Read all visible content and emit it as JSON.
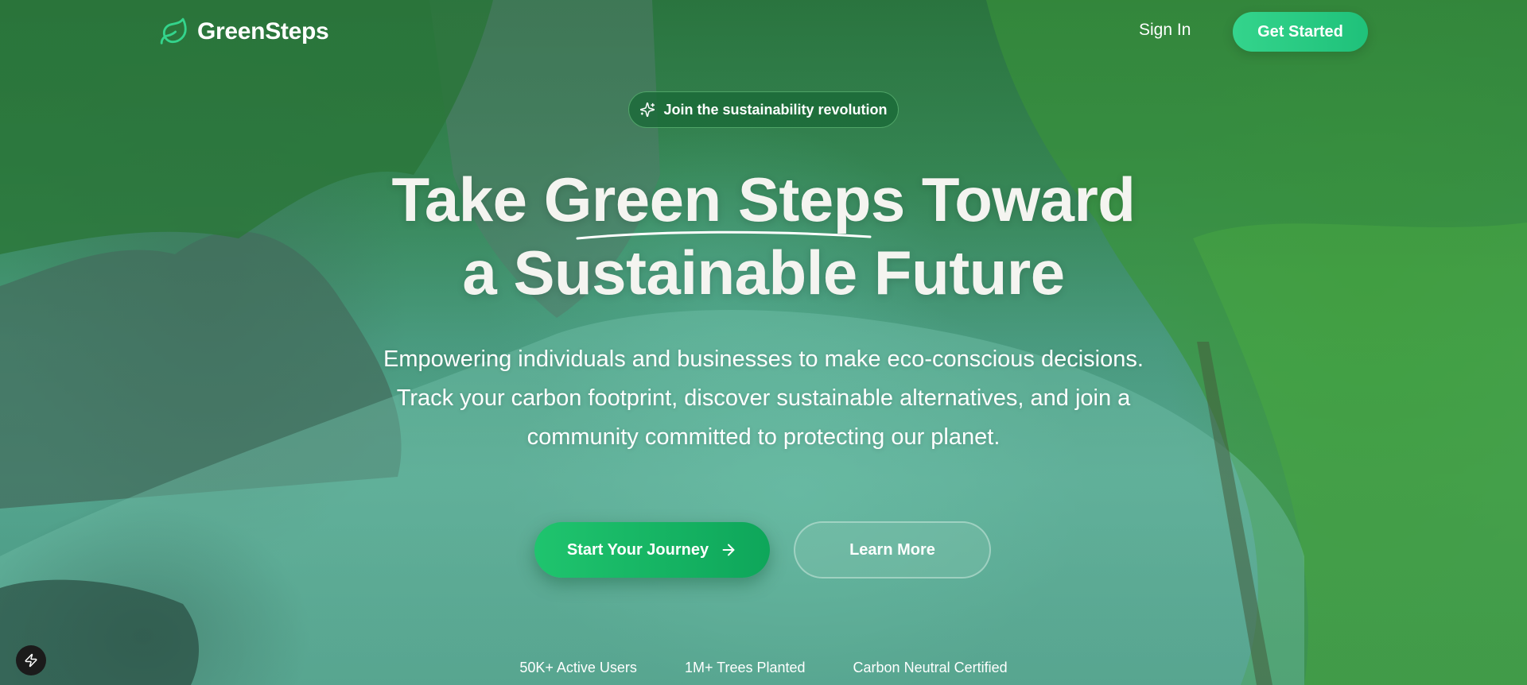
{
  "nav": {
    "brand": "GreenSteps",
    "sign_in": "Sign In",
    "get_started": "Get Started"
  },
  "badge": {
    "icon": "sparkles-icon",
    "text": "Join the sustainability revolution"
  },
  "headline": {
    "line1": "Take Green Steps Toward",
    "line2": "a Sustainable Future"
  },
  "subtext": {
    "line1": "Empowering individuals and businesses to make eco-conscious decisions.",
    "line2": "Track your carbon footprint, discover sustainable alternatives, and join a",
    "line3": "community committed to protecting our planet."
  },
  "cta": {
    "primary": "Start Your Journey",
    "primary_icon": "arrow-right-icon",
    "secondary": "Learn More"
  },
  "stats": [
    "50K+ Active Users",
    "1M+ Trees Planted",
    "Carbon Neutral Certified"
  ],
  "colors": {
    "brand_green": "#1fc46e",
    "accent_green": "#34d48c",
    "text": "#ffffff"
  },
  "floating_button": {
    "icon": "lightning-bolt-icon"
  }
}
